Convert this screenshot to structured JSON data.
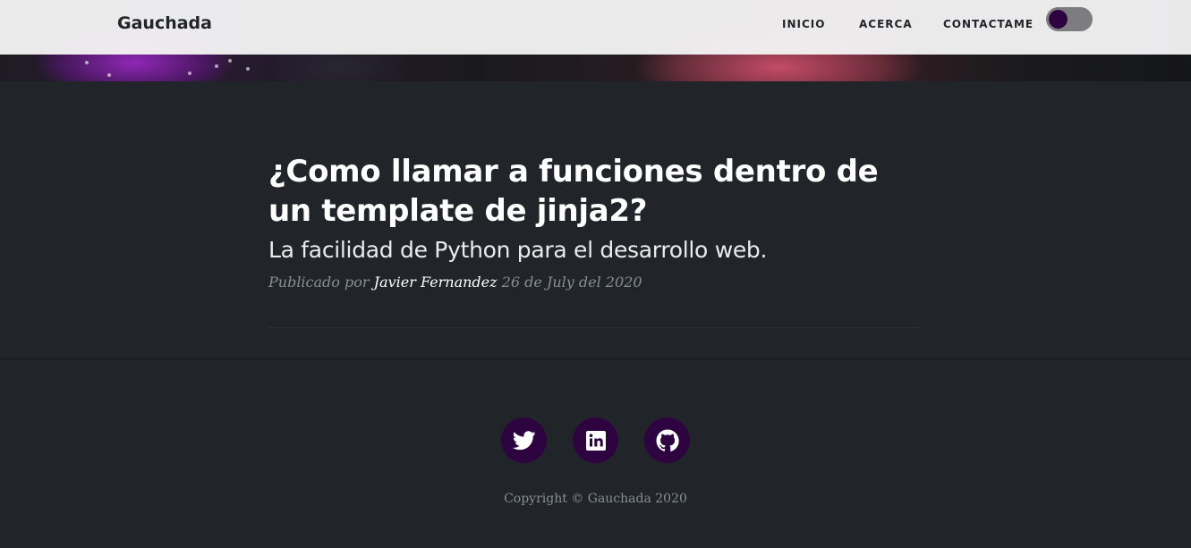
{
  "navbar": {
    "brand": "Gauchada",
    "links": [
      {
        "label": "INICIO"
      },
      {
        "label": "ACERCA"
      },
      {
        "label": "CONTACTAME"
      }
    ],
    "theme_toggle": {
      "state": "dark"
    }
  },
  "post": {
    "title": "¿Como llamar a funciones dentro de un template de jinja2?",
    "subtitle": "La facilidad de Python para el desarrollo web.",
    "meta": {
      "prefix": "Publicado por",
      "author": "Javier Fernandez",
      "date": "26 de July del 2020"
    }
  },
  "footer": {
    "social": [
      {
        "icon": "twitter-icon"
      },
      {
        "icon": "linkedin-icon"
      },
      {
        "icon": "github-icon"
      }
    ],
    "copyright": "Copyright © Gauchada 2020"
  },
  "colors": {
    "background": "#212529",
    "accent": "#2d0440",
    "navbar": "#f4f2f4",
    "muted_text": "#868e96"
  }
}
